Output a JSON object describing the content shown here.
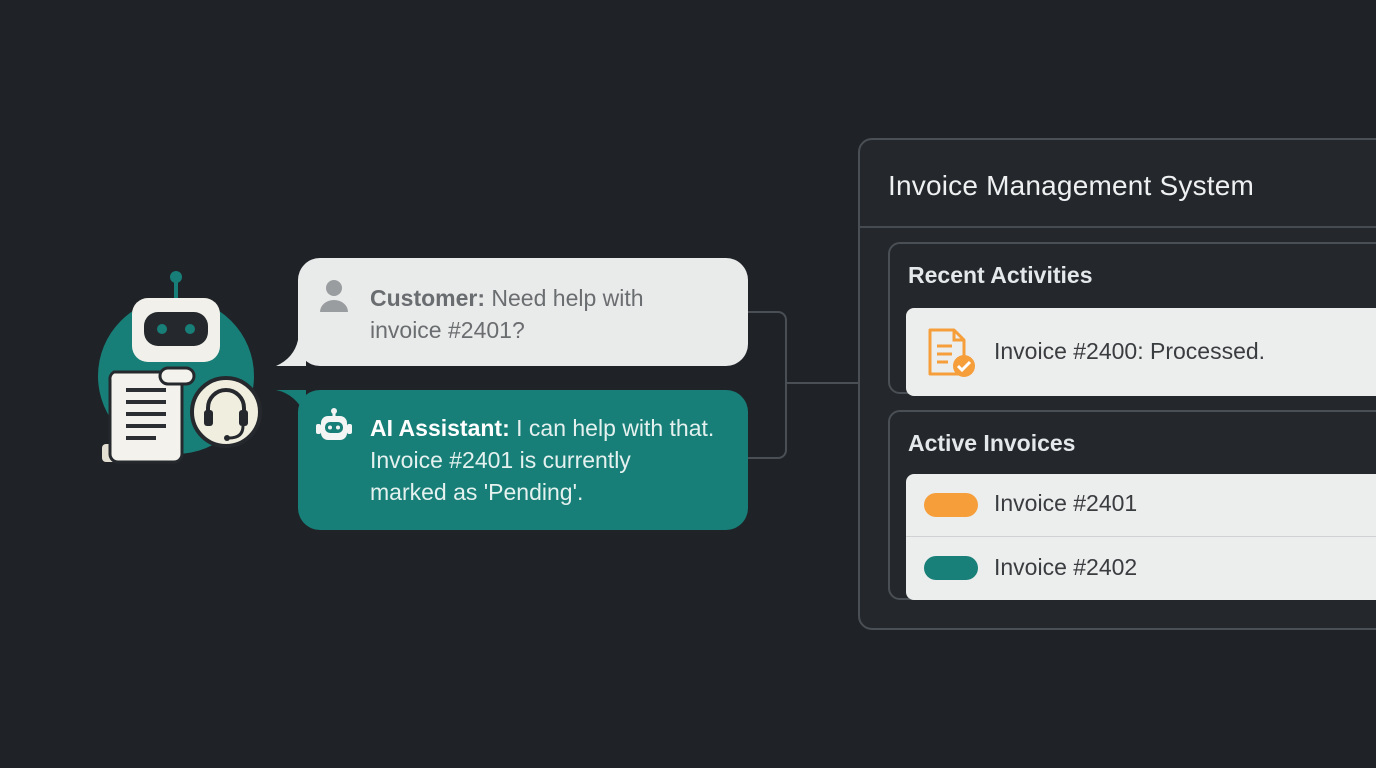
{
  "chat": {
    "customer": {
      "speaker": "Customer:",
      "line1": " Need help with",
      "line2": "invoice #2401?"
    },
    "assistant": {
      "speaker": "AI Assistant:",
      "line1": " I can help with that.",
      "line2": "Invoice #2401 is currently",
      "line3": "marked as 'Pending'."
    }
  },
  "panel": {
    "title": "Invoice Management System",
    "recent": {
      "title": "Recent Activities",
      "items": [
        {
          "text": "Invoice #2400: Processed.",
          "icon": "invoice-check-icon"
        }
      ]
    },
    "active": {
      "title": "Active Invoices",
      "items": [
        {
          "text": "Invoice #2401",
          "color": "#f59e3a"
        },
        {
          "text": "Invoice #2402",
          "color": "#188078"
        }
      ]
    }
  },
  "colors": {
    "background": "#1f2327",
    "accent_teal": "#187f78",
    "accent_orange": "#f59e3a",
    "bubble_light": "#e9eaea"
  },
  "icons": {
    "illustration": "robot-document-headset-icon",
    "customer": "user-icon",
    "assistant": "robot-icon"
  }
}
